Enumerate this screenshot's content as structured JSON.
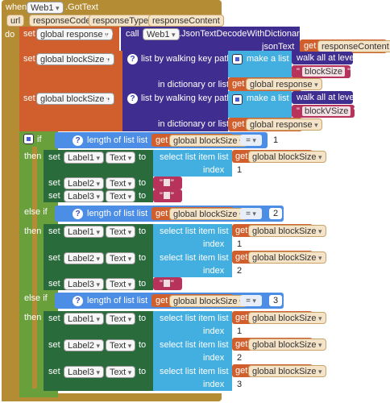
{
  "event": {
    "when": "when",
    "component": "Web1",
    "handler": ".GotText",
    "do": "do",
    "params": [
      "url",
      "responseCode",
      "responseType",
      "responseContent"
    ]
  },
  "set1": {
    "set": "set",
    "var": "global response",
    "to": "to",
    "call": "call",
    "component": "Web1",
    "method": ".JsonTextDecodeWithDictionaries",
    "arg": "jsonText",
    "get": "get",
    "getvar": "responseContent"
  },
  "set2": {
    "set": "set",
    "var": "global blockSize",
    "to": "to",
    "walk": "list by walking key path",
    "make": "make a list",
    "walkall": "walk all at level",
    "key": "blockSize",
    "indict": "in dictionary or list",
    "get": "get",
    "getvar": "global response"
  },
  "set3": {
    "set": "set",
    "var": "global blockSize",
    "to": "to",
    "walk": "list by walking key path",
    "make": "make a list",
    "walkall": "walk all at level",
    "key": "blockVSize",
    "indict": "in dictionary or list",
    "get": "get",
    "getvar": "global response"
  },
  "ifblock": {
    "if": "if",
    "then": "then",
    "elseif": "else if",
    "length": "length of list  list",
    "get": "get",
    "getvar": "global blockSize",
    "eq": "=",
    "n1": "1",
    "n2": "2",
    "n3": "3",
    "set": "set",
    "text": "Text",
    "to": "to",
    "select": "select list item  list",
    "index": "index",
    "label1": "Label1",
    "label2": "Label2",
    "label3": "Label3"
  }
}
